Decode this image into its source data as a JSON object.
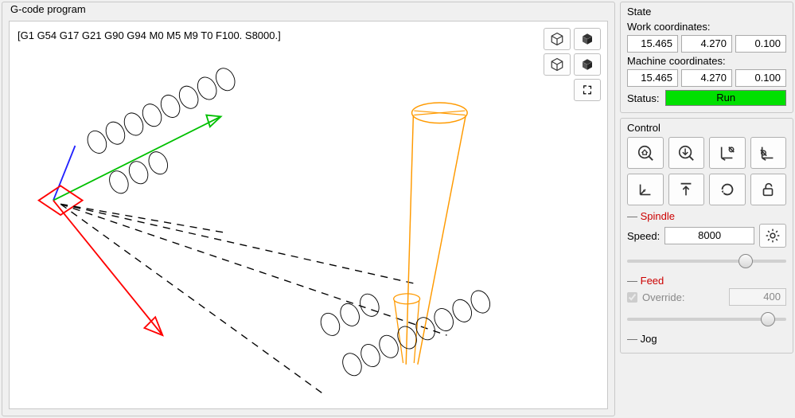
{
  "left": {
    "title": "G-code program",
    "gcode": "[G1 G54 G17 G21 G90 G94 M0 M5 M9 T0 F100. S8000.]"
  },
  "state": {
    "title": "State",
    "work_label": "Work coordinates:",
    "work": {
      "x": "15.465",
      "y": "4.270",
      "z": "0.100"
    },
    "machine_label": "Machine coordinates:",
    "machine": {
      "x": "15.465",
      "y": "4.270",
      "z": "0.100"
    },
    "status_label": "Status:",
    "status_value": "Run"
  },
  "control": {
    "title": "Control"
  },
  "spindle": {
    "dash": "—",
    "title": "Spindle",
    "speed_label": "Speed:",
    "speed_value": "8000"
  },
  "feed": {
    "dash": "—",
    "title": "Feed",
    "override_label": "Override:",
    "override_value": "400"
  },
  "jog": {
    "dash": "—",
    "title": "Jog"
  }
}
